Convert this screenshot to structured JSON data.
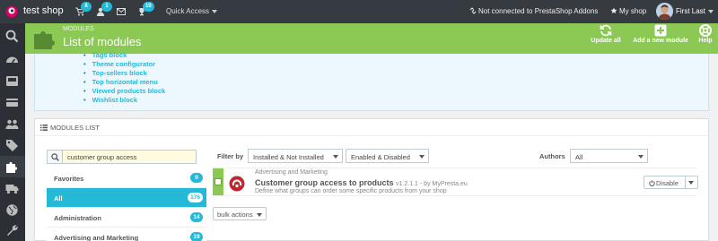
{
  "topbar": {
    "shop_name": "test shop",
    "orders_badge": "8",
    "customers_badge": "1",
    "messages_badge": "",
    "notifications_badge": "10",
    "quick_access": "Quick Access",
    "addons_status": "Not connected to PrestaShop Addons",
    "my_shop": "My shop",
    "user_name": "First Last"
  },
  "header": {
    "breadcrumb": "Modules",
    "title": "List of modules",
    "update_all": "Update all",
    "add_module": "Add a new module",
    "help": "Help"
  },
  "recommended": {
    "items": [
      "Tags block",
      "Theme configurator",
      "Top-sellers block",
      "Top horizontal menu",
      "Viewed products block",
      "Wishlist block"
    ]
  },
  "modules_list": {
    "heading": "Modules list",
    "search_value": "customer group access",
    "categories": [
      {
        "label": "Favorites",
        "count": "0"
      },
      {
        "label": "All",
        "count": "176"
      },
      {
        "label": "Administration",
        "count": "14"
      },
      {
        "label": "Advertising and Marketing",
        "count": "19"
      }
    ],
    "filter_label": "Filter by",
    "install_filter": "Installed & Not Installed",
    "status_filter": "Enabled & Disabled",
    "authors_label": "Authors",
    "authors_filter": "All",
    "module": {
      "category": "Advertising and Marketing",
      "name": "Customer group access to products",
      "version": "v1.2.1.1 - by MyPresta.eu",
      "description": "Define what groups can order some specific products from your shop",
      "disable_label": "Disable"
    },
    "bulk_actions": "bulk actions"
  },
  "colors": {
    "topbar": "#363a41",
    "sidebar": "#2c2f35",
    "header_green": "#8bc954",
    "accent_blue": "#25b9d7"
  }
}
